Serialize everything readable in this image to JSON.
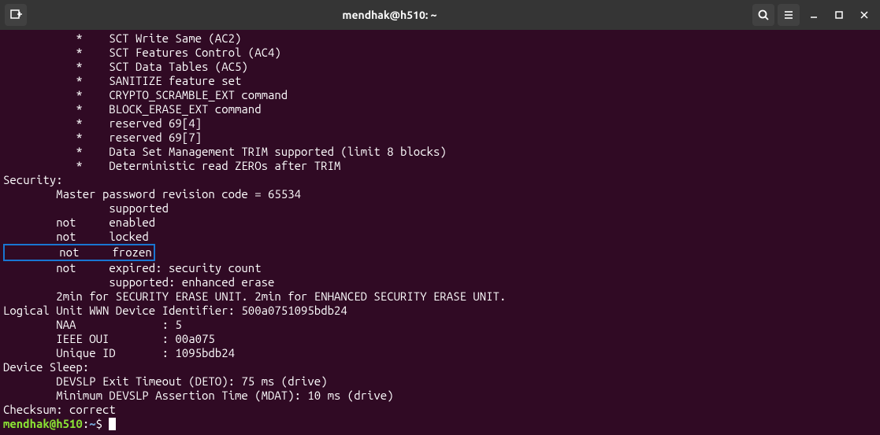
{
  "titlebar": {
    "title": "mendhak@h510: ~",
    "newTab": "+",
    "search": "⌕",
    "menu": "≡",
    "minimize": "–",
    "maximize": "□",
    "close": "✕"
  },
  "terminal": {
    "lines": [
      "           *\tSCT Write Same (AC2)",
      "           *\tSCT Features Control (AC4)",
      "           *\tSCT Data Tables (AC5)",
      "           *\tSANITIZE feature set",
      "           *\tCRYPTO_SCRAMBLE_EXT command",
      "           *\tBLOCK_ERASE_EXT command",
      "           *\treserved 69[4]",
      "           *\treserved 69[7]",
      "           *\tData Set Management TRIM supported (limit 8 blocks)",
      "           *\tDeterministic read ZEROs after TRIM"
    ],
    "securityHeader": "Security: ",
    "securityLines": [
      "\tMaster password revision code = 65534",
      "\t\tsupported",
      "\tnot\tenabled",
      "\tnot\tlocked"
    ],
    "highlightedLine": "\tnot\tfrozen",
    "securityLinesAfter": [
      "\tnot\texpired: security count",
      "\t\tsupported: enhanced erase",
      "\t2min for SECURITY ERASE UNIT. 2min for ENHANCED SECURITY ERASE UNIT."
    ],
    "wwnHeader": "Logical Unit WWN Device Identifier: 500a0751095bdb24",
    "wwnLines": [
      "\tNAA\t\t: 5",
      "\tIEEE OUI\t: 00a075",
      "\tUnique ID\t: 1095bdb24"
    ],
    "devSleepHeader": "Device Sleep:",
    "devSleepLines": [
      "\tDEVSLP Exit Timeout (DETO): 75 ms (drive)",
      "\tMinimum DEVSLP Assertion Time (MDAT): 10 ms (drive)"
    ],
    "checksum": "Checksum: correct",
    "prompt": {
      "user": "mendhak@h510",
      "separator": ":",
      "path": "~",
      "dollar": "$"
    }
  }
}
